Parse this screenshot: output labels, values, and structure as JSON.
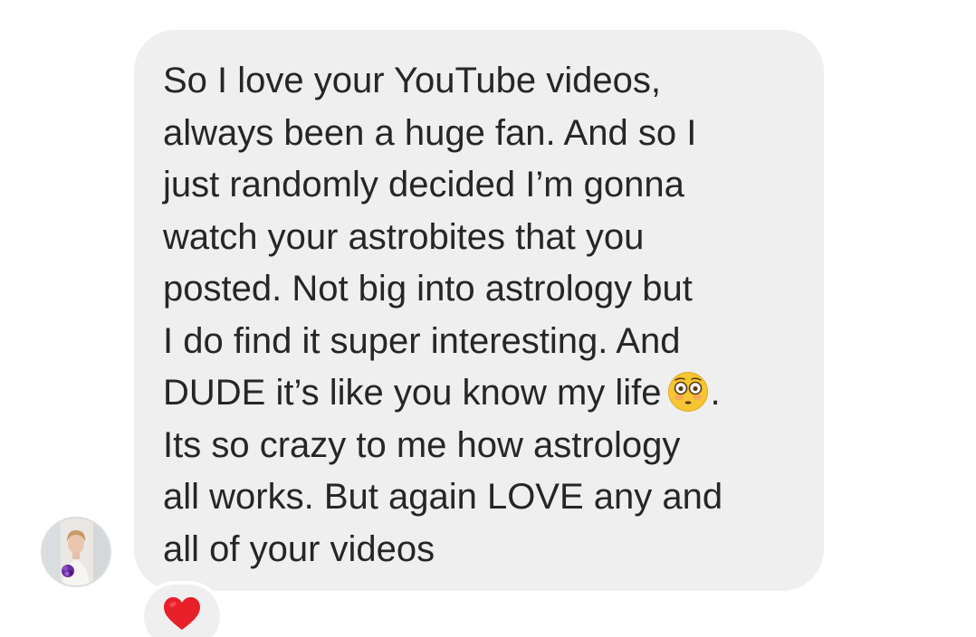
{
  "message": {
    "lines": [
      "So I love your YouTube videos,",
      "always been a huge fan. And so  I",
      "just randomly decided I’m gonna",
      "watch your astrobites that you",
      "posted. Not big into astrology but",
      "I do find it super interesting. And",
      "DUDE it’s like you know my life",
      ".",
      "Its so crazy to me how astrology",
      "all works. But again LOVE any and",
      "all of your videos"
    ],
    "inline_emoji": "flushed-face-emoji"
  },
  "reaction": {
    "emoji": "red-heart-emoji"
  },
  "colors": {
    "bubble_background": "#efefef",
    "text": "#262626",
    "heart": "#e8202a",
    "emoji_face": "#f7c531"
  }
}
